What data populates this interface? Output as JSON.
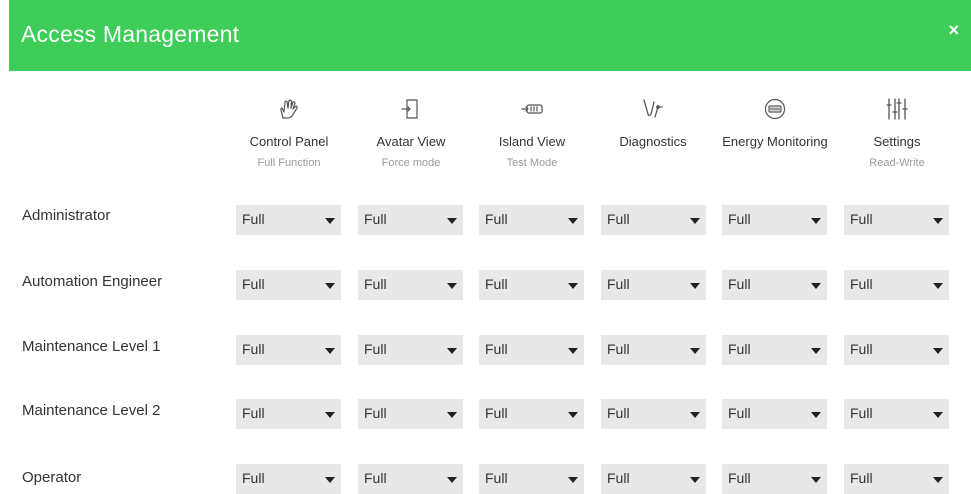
{
  "header": {
    "title": "Access Management",
    "close_label": "×"
  },
  "columns": [
    {
      "label": "Control Panel",
      "sub": "Full Function",
      "icon": "hand-touch-icon"
    },
    {
      "label": "Avatar View",
      "sub": "Force mode",
      "icon": "door-enter-icon"
    },
    {
      "label": "Island View",
      "sub": "Test Mode",
      "icon": "island-module-icon"
    },
    {
      "label": "Diagnostics",
      "sub": "",
      "icon": "stethoscope-icon"
    },
    {
      "label": "Energy Monitoring",
      "sub": "",
      "icon": "energy-meter-icon"
    },
    {
      "label": "Settings",
      "sub": "Read-Write",
      "icon": "sliders-icon"
    }
  ],
  "rows": [
    {
      "label": "Administrator",
      "values": [
        "Full",
        "Full",
        "Full",
        "Full",
        "Full",
        "Full"
      ]
    },
    {
      "label": "Automation Engineer",
      "values": [
        "Full",
        "Full",
        "Full",
        "Full",
        "Full",
        "Full"
      ]
    },
    {
      "label": "Maintenance Level 1",
      "values": [
        "Full",
        "Full",
        "Full",
        "Full",
        "Full",
        "Full"
      ]
    },
    {
      "label": "Maintenance Level 2",
      "values": [
        "Full",
        "Full",
        "Full",
        "Full",
        "Full",
        "Full"
      ]
    },
    {
      "label": "Operator",
      "values": [
        "Full",
        "Full",
        "Full",
        "Full",
        "Full",
        "Full"
      ]
    }
  ],
  "colors": {
    "header_bg": "#3dcd58",
    "select_bg": "#e8e8e8"
  }
}
